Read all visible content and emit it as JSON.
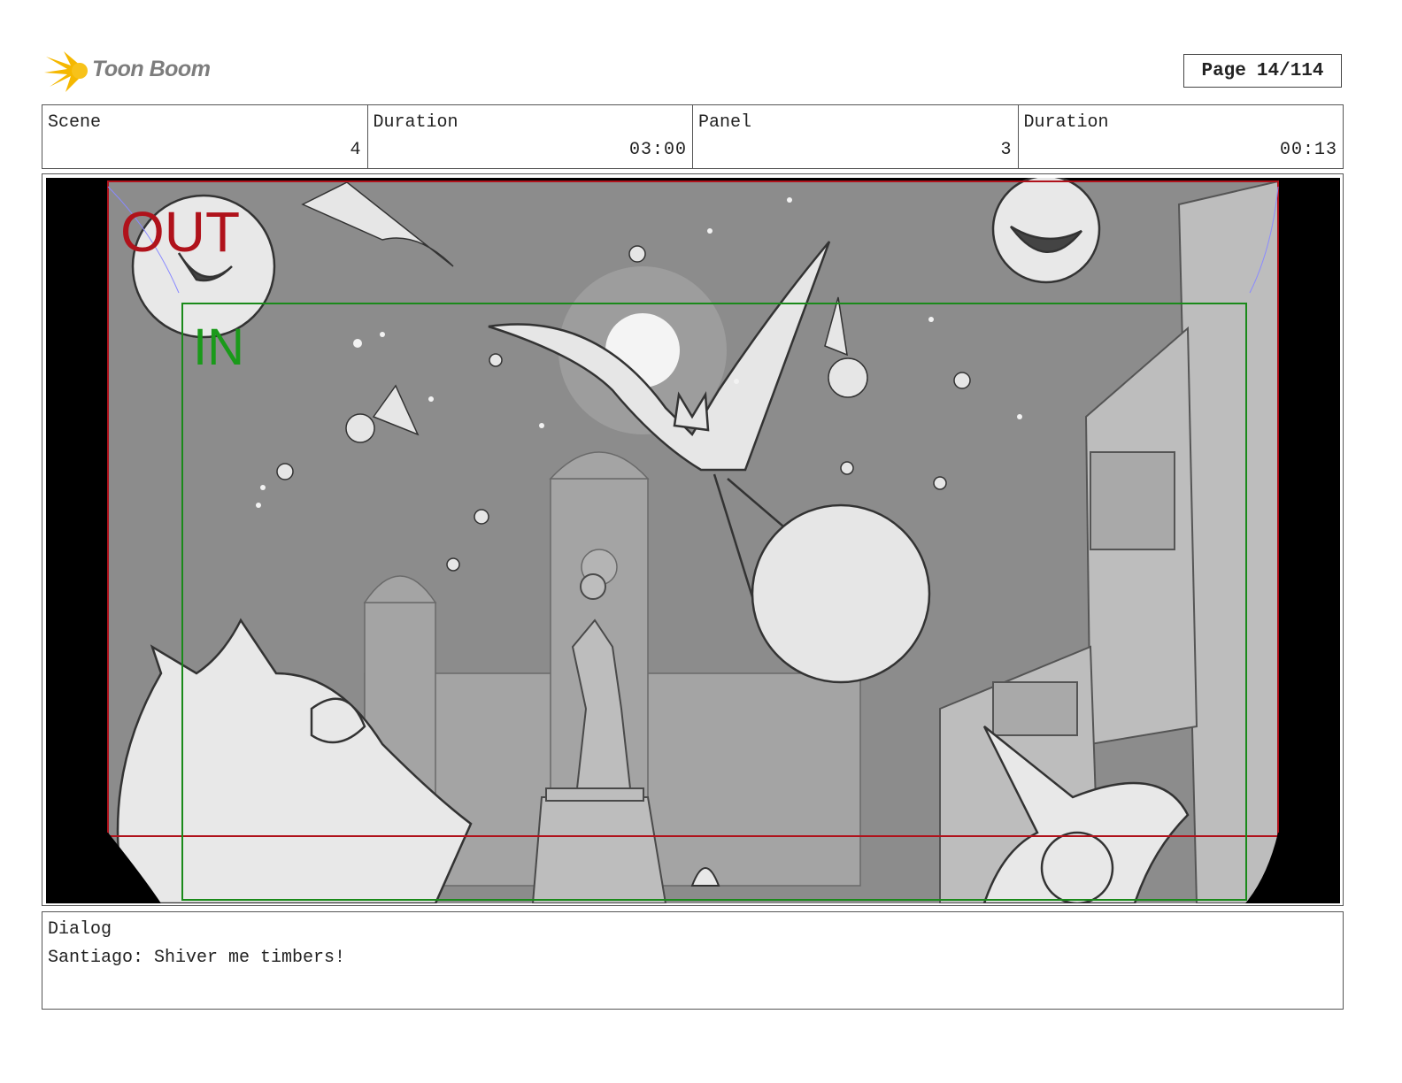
{
  "header": {
    "brand": "Toon Boom",
    "page_label": "Page",
    "page_value": "14/114"
  },
  "meta": {
    "scene_label": "Scene",
    "scene_value": "4",
    "scene_duration_label": "Duration",
    "scene_duration_value": "03:00",
    "panel_label": "Panel",
    "panel_value": "3",
    "panel_duration_label": "Duration",
    "panel_duration_value": "00:13"
  },
  "frame": {
    "out_label": "OUT",
    "in_label": "IN",
    "colors": {
      "out": "#b0121b",
      "in": "#1a9a1a",
      "sky": "#8a8a8a",
      "ink": "#3a3a3a"
    }
  },
  "dialog": {
    "label": "Dialog",
    "text": "Santiago: Shiver me timbers!"
  }
}
